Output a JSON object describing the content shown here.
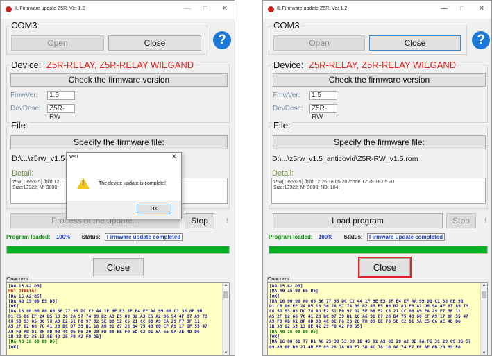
{
  "app": {
    "title": "IL Firmware update Z5R. Ver 1.2",
    "min_glyph": "—",
    "max_glyph": "☐",
    "close_glyph": "✕",
    "icon": "app-icon"
  },
  "left": {
    "port": "COM3",
    "open_label": "Open",
    "close_port_label": "Close",
    "help_label": "?",
    "device_label": "Device:",
    "device_value": "Z5R-RELAY, Z5R-RELAY WIEGAND",
    "check_label": "Check the firmware version",
    "fmw_label": "FmwVer:",
    "fmw_value": "1.5",
    "devdesc_label": "DevDesc:",
    "devdesc_value": "Z5R-RW",
    "file_label": "File:",
    "specify_label": "Specify the firmware file:",
    "path": "D:\\...\\z5rw_v1.5",
    "detail_label": "Detail:",
    "detail_lines": [
      "z5w(1-65535) /bild 12",
      "Size:13922; M: 3888;"
    ],
    "process_label": "Process of the update...",
    "stop_label": "Stop",
    "side_mark": "!",
    "program_loaded_label": "Program loaded:",
    "program_loaded_value": "100%",
    "status_label": "Status:",
    "status_value": "Firmware update completed",
    "progress": 1.0,
    "close_label": "Close",
    "clear_label": "Очистить",
    "log": [
      {
        "t": "[DA 15 A2 D5]",
        "k": "n"
      },
      {
        "t": "НЕТ ОТВЕТА!",
        "k": "bad"
      },
      {
        "t": "[DA 15 A2 D5]",
        "k": "n"
      },
      {
        "t": "[DA A0 15 00 E5 D5]",
        "k": "n"
      },
      {
        "t": "[OK]",
        "k": "n"
      },
      {
        "t": "[DA 16 00 00 A0 69 56 77 95 DC C2 44 1F 9E E3 5F E4 EF AA 99 0B C1 38 8E 9B",
        "k": "n"
      },
      {
        "t": "D1 C6 06 EF 24 B5 13 36 2A 97 74 09 B2 A3 E5 09 B2 A3 E5 A2 D6 94 4F 87 A9 73",
        "k": "n"
      },
      {
        "t": "C0 5D 93 05 DC 78 AD E2 51 F0 97 D2 5E B8 52 C5 21 CC 08 A9 EA 29 F7 3F 11",
        "k": "n"
      },
      {
        "t": "A5 2F 02 66 7C 41 23 BC D7 39 B1 18 A6 91 87 28 B4 75 43 60 CF A9 17 DF 55 47",
        "k": "n"
      },
      {
        "t": "A9 F9 AB 81 8F 8D 98 4C 0E F6 20 28 FD 89 EE F0 5D C2 D1 5A E5 0A AE 4D D6",
        "k": "n"
      },
      {
        "t": "1B 33 02 35 13 8E 42 25 F0 42 F9 D5]",
        "k": "n"
      },
      {
        "t": "[DA A0 16 00 B0 D5]",
        "k": "ok"
      },
      {
        "t": "[OK]",
        "k": "n"
      }
    ]
  },
  "dialog": {
    "title": "Yes!",
    "close_glyph": "✕",
    "warn_glyph": "!",
    "message": "The device update is complete!",
    "ok_label": "OK"
  },
  "right": {
    "port": "COM3",
    "open_label": "Open",
    "close_port_label": "Close",
    "help_label": "?",
    "device_label": "Device:",
    "device_value": "Z5R-RELAY, Z5R-RELAY WIEGAND",
    "check_label": "Check the firmware version",
    "fmw_label": "FmwVer:",
    "fmw_value": "1.5",
    "devdesc_label": "DevDesc:",
    "devdesc_value": "Z5R-RW",
    "file_label": "File:",
    "specify_label": "Specify the firmware file:",
    "path": "D:\\...\\z5rw_v1.5_anticovid\\Z5R-RW_v1.5.rom",
    "detail_label": "Detail:",
    "detail_lines": [
      "z5w(1-65535) /bild 12:26 18.05.20 /code 12:28 18.05.20",
      "Size:13922; M: 3888; NB: 104;"
    ],
    "load_label": "Load program",
    "stop_label": "Stop",
    "side_mark": "!",
    "program_loaded_label": "Program loaded:",
    "program_loaded_value": "100%",
    "status_label": "Status:",
    "status_value": "Firmware update completed",
    "progress": 1.0,
    "close_label": "Close",
    "clear_label": "Очистить",
    "log": [
      {
        "t": "[DA 15 A2 D5]",
        "k": "n"
      },
      {
        "t": "[DA A0 15 00 E5 D5]",
        "k": "n"
      },
      {
        "t": "[OK]",
        "k": "n"
      },
      {
        "t": "[DA 16 00 00 A0 69 56 77 95 DC C2 44 1F 9E E3 5F E4 EF AA 99 0B C1 38 8E 9B",
        "k": "n"
      },
      {
        "t": "D1 C6 06 EF 24 B5 13 36 2A 97 74 09 B2 A3 E5 09 B2 A3 E5 A2 D6 94 4F 87 A9 73",
        "k": "n"
      },
      {
        "t": "C0 5D 93 05 DC 78 AD E2 51 F0 97 D2 5E B8 52 C5 21 CC 08 A9 EA 29 F7 3F 11",
        "k": "n"
      },
      {
        "t": "A5 2F 02 66 7C 41 23 BC D7 39 B1 18 A6 91 87 28 B4 75 43 60 CF A9 17 DF 55 47",
        "k": "n"
      },
      {
        "t": "A9 F9 AB 81 8F 8D 98 4C 0E F6 20 28 FD 89 EE F0 5D C2 D1 5A E5 0A AE 4D D6",
        "k": "n"
      },
      {
        "t": "1B 33 02 35 13 8E 42 25 F0 42 F9 D5]",
        "k": "n"
      },
      {
        "t": "[DA A0 16 00 B0 D5]",
        "k": "ok"
      },
      {
        "t": "[OK]",
        "k": "n"
      },
      {
        "t": "[DA 16 00 01 77 D1 A6 25 30 53 33 1B 45 01 A9 88 20 A2 3D 6A F6 31 28 C9 35 57",
        "k": "n"
      },
      {
        "t": "09 89 0E B9 21 4B FE 89 26 7A 6B F7 3B 4C 78 1B AA 74 F7 FF AE 6B 29 99 E0",
        "k": "n"
      }
    ]
  }
}
